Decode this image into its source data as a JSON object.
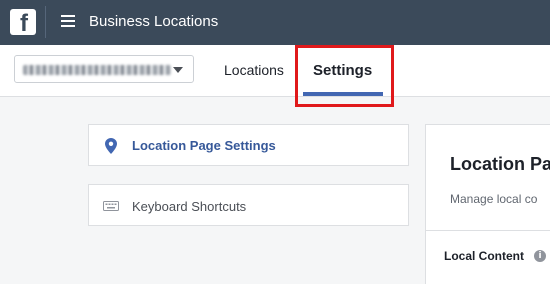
{
  "header": {
    "logo_letter": "f",
    "title": "Business Locations"
  },
  "page_selector": {
    "value": ""
  },
  "tabs": [
    {
      "label": "Locations",
      "active": false
    },
    {
      "label": "Settings",
      "active": true
    }
  ],
  "sidebar": {
    "items": [
      {
        "label": "Location Page Settings",
        "icon": "location-pin-icon",
        "active": true
      },
      {
        "label": "Keyboard Shortcuts",
        "icon": "keyboard-icon",
        "active": false
      }
    ]
  },
  "main": {
    "title": "Location Pa",
    "subtitle": "Manage local co",
    "section_label": "Local Content",
    "info_glyph": "i"
  },
  "colors": {
    "topbar": "#3b4a5a",
    "accent": "#4267b2",
    "highlight": "#e0191b",
    "active_link": "#365899"
  }
}
